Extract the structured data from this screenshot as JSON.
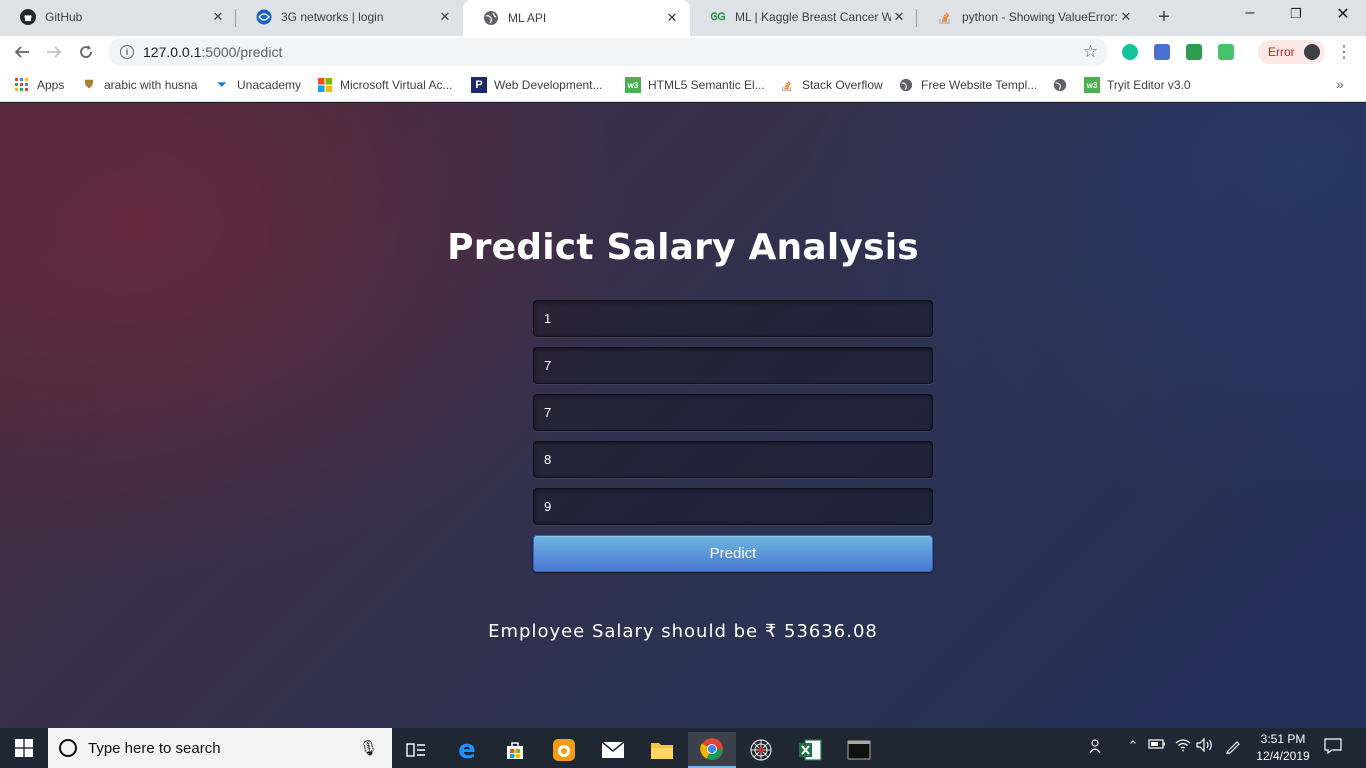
{
  "browser": {
    "tabs": [
      {
        "title": "GitHub",
        "icon": "github-icon",
        "active": false
      },
      {
        "title": "3G networks | login",
        "icon": "globe-blue-icon",
        "active": false
      },
      {
        "title": "ML API",
        "icon": "globe-icon",
        "active": true
      },
      {
        "title": "ML | Kaggle Breast Cancer Wisc",
        "icon": "geeksforgeeks-icon",
        "active": false
      },
      {
        "title": "python - Showing ValueError: s",
        "icon": "stackoverflow-icon",
        "active": false
      }
    ],
    "address": {
      "host": "127.0.0.1",
      "path": ":5000/predict"
    },
    "profile_status": "Error",
    "bookmarks": [
      {
        "label": "Apps",
        "icon": "apps-grid-icon"
      },
      {
        "label": "arabic with husna",
        "icon": "shield-crest-icon"
      },
      {
        "label": "Unacademy",
        "icon": "unacademy-icon"
      },
      {
        "label": "Microsoft Virtual Ac...",
        "icon": "microsoft-icon"
      },
      {
        "label": "Web Development...",
        "icon": "p-logo-icon"
      },
      {
        "label": "HTML5 Semantic El...",
        "icon": "w3schools-icon"
      },
      {
        "label": "Stack Overflow",
        "icon": "stackoverflow-icon"
      },
      {
        "label": "Free Website Templ...",
        "icon": "globe-icon"
      },
      {
        "label": "",
        "icon": "globe-icon"
      },
      {
        "label": "Tryit Editor v3.0",
        "icon": "w3schools-icon"
      }
    ]
  },
  "page": {
    "heading": "Predict Salary Analysis",
    "fields": [
      {
        "value": "1"
      },
      {
        "value": "7"
      },
      {
        "value": "7"
      },
      {
        "value": "8"
      },
      {
        "value": "9"
      }
    ],
    "predict_label": "Predict",
    "result_text": "Employee Salary should be ₹ 53636.08"
  },
  "taskbar": {
    "search_placeholder": "Type here to search",
    "time": "3:51 PM",
    "date": "12/4/2019"
  }
}
